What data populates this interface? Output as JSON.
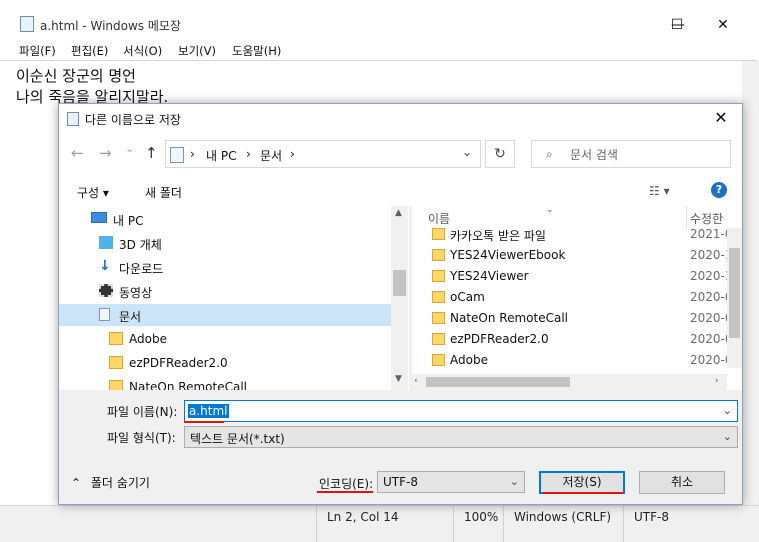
{
  "notepad": {
    "title": "a.html - Windows 메모장",
    "window_controls": {
      "minimize": "—",
      "maximize": "☐",
      "close": "✕"
    },
    "menu": [
      "파일(F)",
      "편집(E)",
      "서식(O)",
      "보기(V)",
      "도움말(H)"
    ],
    "content_lines": [
      "이순신 장군의 명언",
      "나의 죽음을 알리지말라."
    ],
    "status": {
      "position": "Ln 2, Col 14",
      "zoom": "100%",
      "line_ending": "Windows (CRLF)",
      "encoding": "UTF-8"
    }
  },
  "dialog": {
    "title": "다른 이름으로 저장",
    "close": "✕",
    "nav": {
      "back": "←",
      "forward": "→",
      "recent": "⌄",
      "up": "↑",
      "refresh": "↻"
    },
    "address": {
      "separator": "›",
      "segments": [
        "내 PC",
        "문서"
      ]
    },
    "search": {
      "placeholder": "문서 검색"
    },
    "toolbar": {
      "organize": "구성 ▾",
      "new_folder": "새 폴더",
      "view": "☷ ▾",
      "help": "?"
    },
    "tree": [
      {
        "label": "내 PC",
        "icon": "pc-icon"
      },
      {
        "label": "3D 개체",
        "icon": "cube-icon"
      },
      {
        "label": "다운로드",
        "icon": "download-icon"
      },
      {
        "label": "동영상",
        "icon": "video-icon"
      },
      {
        "label": "문서",
        "icon": "document-icon",
        "selected": true
      },
      {
        "label": "Adobe",
        "icon": "folder-icon"
      },
      {
        "label": "ezPDFReader2.0",
        "icon": "folder-icon"
      },
      {
        "label": "NateOn RemoteCall",
        "icon": "folder-icon"
      }
    ],
    "file_list": {
      "columns": {
        "name": "이름",
        "modified": "수정한"
      },
      "rows": [
        {
          "name": "카카오톡 받은 파일",
          "date": "2021-0"
        },
        {
          "name": "YES24ViewerEbook",
          "date": "2020-1"
        },
        {
          "name": "YES24Viewer",
          "date": "2020-1"
        },
        {
          "name": "oCam",
          "date": "2020-0"
        },
        {
          "name": "NateOn RemoteCall",
          "date": "2020-0"
        },
        {
          "name": "ezPDFReader2.0",
          "date": "2020-0"
        },
        {
          "name": "Adobe",
          "date": "2020-0"
        }
      ]
    },
    "form": {
      "filename_label": "파일 이름(N):",
      "filename_value": "a.html",
      "filetype_label": "파일 형식(T):",
      "filetype_value": "텍스트 문서(*.txt)",
      "encoding_label": "인코딩(E):",
      "encoding_value": "UTF-8",
      "save": "저장(S)",
      "cancel": "취소",
      "hide_folders": "폴더 숨기기"
    },
    "annotation_color": "#e0140a",
    "accent_color": "#0078d7"
  }
}
